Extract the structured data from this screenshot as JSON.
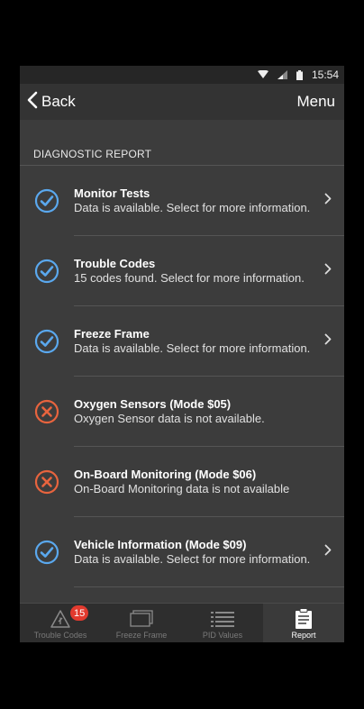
{
  "status_bar": {
    "time": "15:54"
  },
  "nav": {
    "back_label": "Back",
    "menu_label": "Menu"
  },
  "section": {
    "title": "DIAGNOSTIC REPORT"
  },
  "report_items": [
    {
      "title": "Monitor Tests",
      "subtitle": "Data is available. Select for more information.",
      "status": "ok",
      "has_chevron": true
    },
    {
      "title": "Trouble Codes",
      "subtitle": "15 codes found. Select for more information.",
      "status": "ok",
      "has_chevron": true
    },
    {
      "title": "Freeze Frame",
      "subtitle": "Data is available. Select for more information.",
      "status": "ok",
      "has_chevron": true
    },
    {
      "title": "Oxygen Sensors (Mode $05)",
      "subtitle": "Oxygen Sensor data is not available.",
      "status": "error",
      "has_chevron": false
    },
    {
      "title": "On-Board Monitoring (Mode $06)",
      "subtitle": "On-Board Monitoring data is not available",
      "status": "error",
      "has_chevron": false
    },
    {
      "title": "Vehicle Information (Mode $09)",
      "subtitle": "Data is available. Select for more information.",
      "status": "ok",
      "has_chevron": true
    }
  ],
  "tabs": [
    {
      "label": "Trouble Codes",
      "icon": "warning-icon",
      "badge": "15",
      "active": false
    },
    {
      "label": "Freeze Frame",
      "icon": "frame-icon",
      "active": false
    },
    {
      "label": "PID Values",
      "icon": "list-icon",
      "active": false
    },
    {
      "label": "Report",
      "icon": "clipboard-icon",
      "active": true
    }
  ],
  "colors": {
    "ok": "#5aa8ee",
    "error": "#e8643e",
    "background": "#3c3c3c"
  }
}
